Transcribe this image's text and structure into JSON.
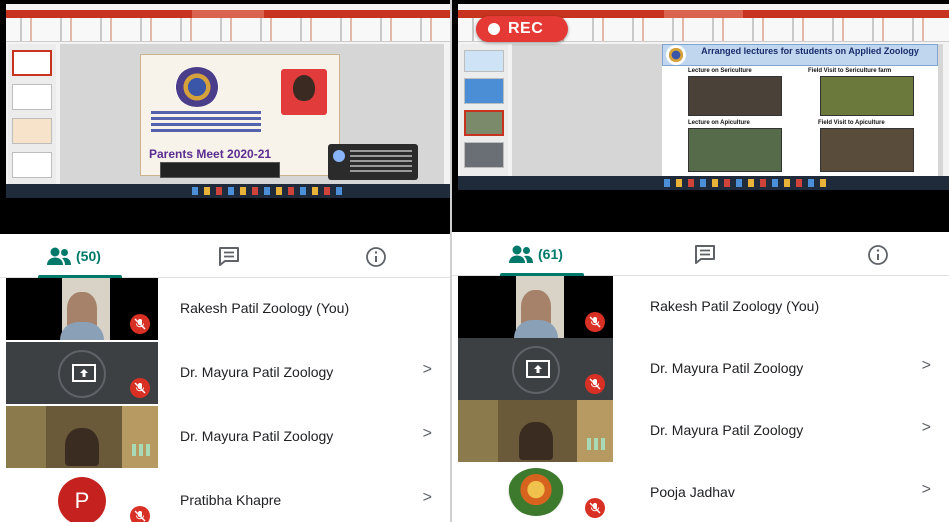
{
  "left": {
    "slide": {
      "title": "Parents Meet 2020-21"
    },
    "tabs": {
      "people_count": "(50)"
    },
    "participants": [
      {
        "name": "Rakesh Patil Zoology (You)",
        "tile": "camera",
        "muted": true,
        "chevron": false
      },
      {
        "name": "Dr. Mayura Patil Zoology",
        "tile": "presenting",
        "muted": true,
        "chevron": true
      },
      {
        "name": "Dr. Mayura Patil Zoology",
        "tile": "camera",
        "muted": false,
        "chevron": true
      },
      {
        "name": "Pratibha Khapre",
        "tile": "avatar",
        "avatar_letter": "P",
        "muted": true,
        "chevron": true
      }
    ]
  },
  "right": {
    "rec_label": "REC",
    "slide": {
      "heading": "Arranged  lectures for students on Applied Zoology",
      "captions": [
        "Lecture on Sericulture",
        "Field Visit to Sericulture farm",
        "Lecture on Apiculture",
        "Field Visit to Apiculture"
      ]
    },
    "tabs": {
      "people_count": "(61)"
    },
    "participants": [
      {
        "name": "Rakesh Patil Zoology (You)",
        "tile": "camera",
        "muted": true,
        "chevron": false
      },
      {
        "name": "Dr. Mayura Patil Zoology",
        "tile": "presenting",
        "muted": true,
        "chevron": true
      },
      {
        "name": "Dr. Mayura Patil Zoology",
        "tile": "camera",
        "muted": false,
        "chevron": true
      },
      {
        "name": "Pooja Jadhav",
        "tile": "image",
        "muted": true,
        "chevron": true
      }
    ]
  },
  "icons": {
    "people": "people-icon",
    "chat": "chat-icon",
    "info": "info-icon",
    "mute": "mic-off-icon",
    "chevron": "chevron-right-icon",
    "present": "present-screen-icon"
  },
  "chevron_glyph": ">",
  "colors": {
    "accent": "#00796b",
    "mute": "#d93025",
    "rec": "#e53935"
  }
}
